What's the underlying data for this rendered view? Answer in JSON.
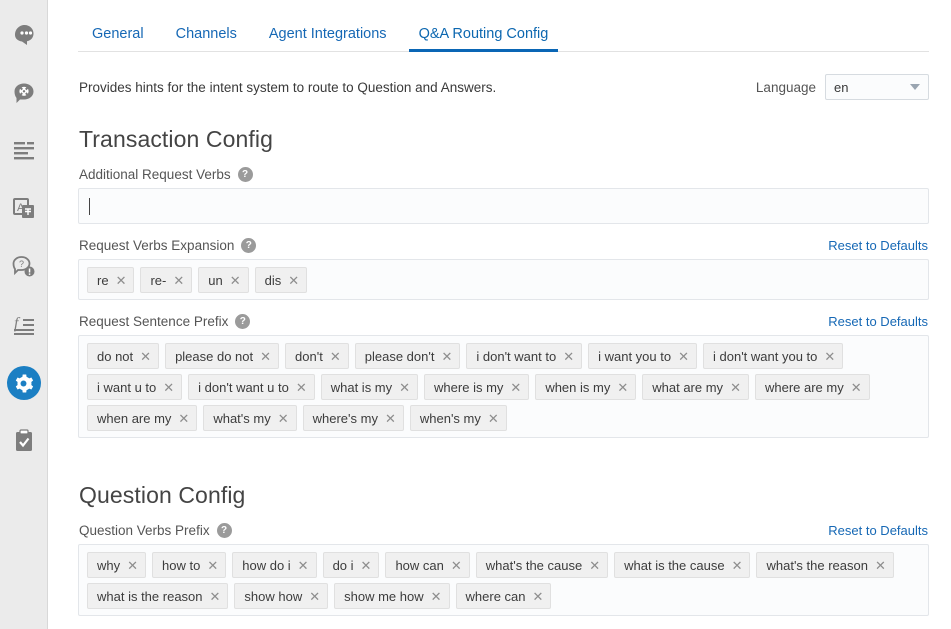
{
  "sidebar": {
    "items": [
      {
        "name": "head-chat-icon",
        "title": "Persona"
      },
      {
        "name": "chat-gear-icon",
        "title": "Dialog Settings"
      },
      {
        "name": "text-lines-icon",
        "title": "Transcripts"
      },
      {
        "name": "translate-icon",
        "title": "Language"
      },
      {
        "name": "question-chat-icon",
        "title": "Q and A"
      },
      {
        "name": "function-lines-icon",
        "title": "Functions"
      },
      {
        "name": "gear-icon",
        "title": "Configuration",
        "active": true
      },
      {
        "name": "clipboard-check-icon",
        "title": "Tasks"
      }
    ]
  },
  "tabs": [
    {
      "label": "General",
      "active": false
    },
    {
      "label": "Channels",
      "active": false
    },
    {
      "label": "Agent Integrations",
      "active": false
    },
    {
      "label": "Q&A Routing Config",
      "active": true
    }
  ],
  "header": {
    "description": "Provides hints for the intent system to route to Question and Answers.",
    "language_label": "Language",
    "language_value": "en"
  },
  "transaction_config": {
    "title": "Transaction Config",
    "additional_request_verbs": {
      "label": "Additional Request Verbs",
      "help": "?",
      "value": "",
      "placeholder": ""
    },
    "request_verbs_expansion": {
      "label": "Request Verbs Expansion",
      "help": "?",
      "reset_label": "Reset to Defaults",
      "chips": [
        "re",
        "re-",
        "un",
        "dis"
      ]
    },
    "request_sentence_prefix": {
      "label": "Request Sentence Prefix",
      "help": "?",
      "reset_label": "Reset to Defaults",
      "chips": [
        "do not",
        "please do not",
        "don't",
        "please don't",
        "i don't want to",
        "i want you to",
        "i don't want you to",
        "i want u to",
        "i don't want u to",
        "what is my",
        "where is my",
        "when is my",
        "what are my",
        "where are my",
        "when are my",
        "what's my",
        "where's my",
        "when's my"
      ]
    }
  },
  "question_config": {
    "title": "Question Config",
    "question_verbs_prefix": {
      "label": "Question Verbs Prefix",
      "help": "?",
      "reset_label": "Reset to Defaults",
      "chips": [
        "why",
        "how to",
        "how do i",
        "do i",
        "how can",
        "what's the cause",
        "what is the cause",
        "what's the reason",
        "what is the reason",
        "show how",
        "show me how",
        "where can"
      ]
    }
  },
  "colors": {
    "accent": "#0a66b5",
    "link": "#1668b5",
    "sidebar_bg": "#ebebeb",
    "chip_bg": "#f0f0f0",
    "active_icon_bg": "#1b7fc3"
  },
  "chip_remove_glyph": "✕"
}
